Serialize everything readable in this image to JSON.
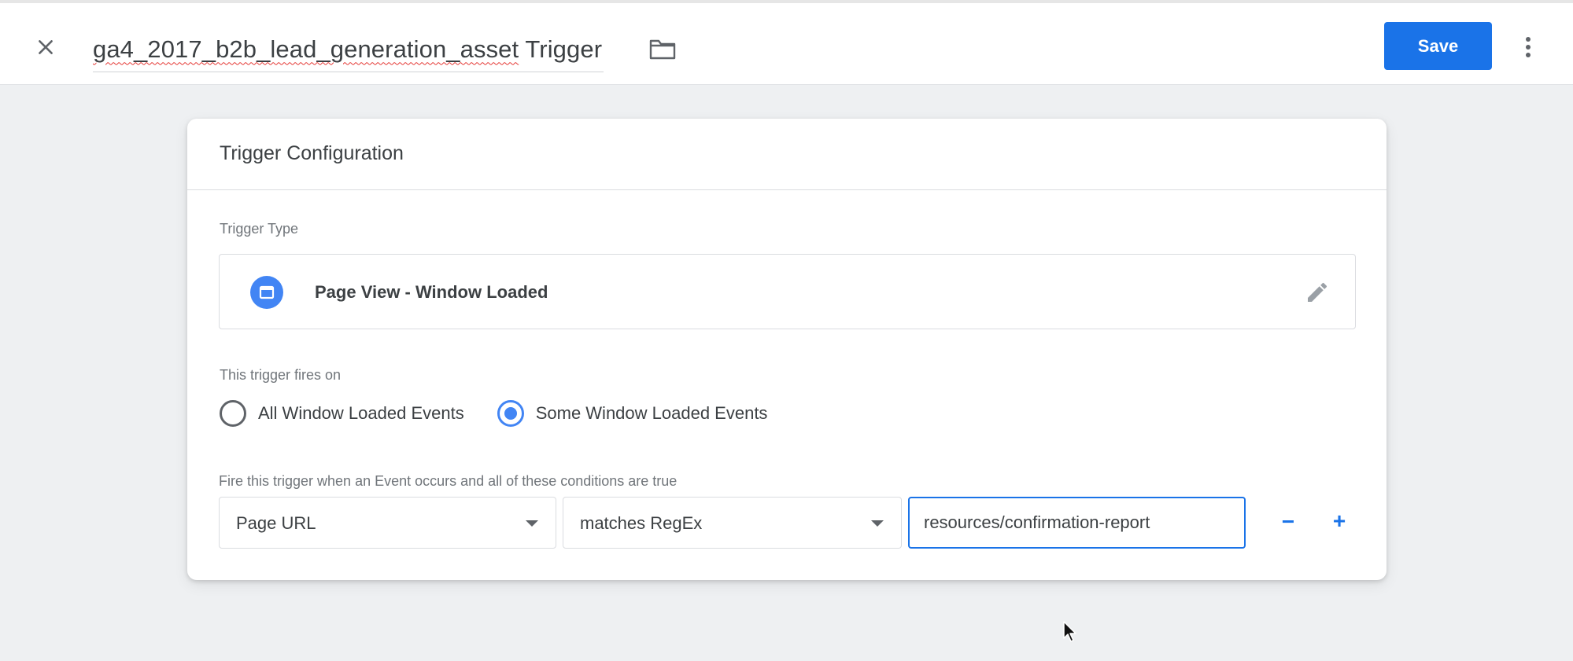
{
  "header": {
    "title_misspelled": "ga4_2017_b2b_lead_generation_asset",
    "title_suffix": " Trigger",
    "save_label": "Save"
  },
  "card": {
    "title": "Trigger Configuration",
    "trigger_type_label": "Trigger Type",
    "trigger_type_name": "Page View - Window Loaded",
    "fires_on_label": "This trigger fires on",
    "options": [
      {
        "label": "All Window Loaded Events",
        "selected": false
      },
      {
        "label": "Some Window Loaded Events",
        "selected": true
      }
    ],
    "conditions_label": "Fire this trigger when an Event occurs and all of these conditions are true",
    "condition": {
      "variable": "Page URL",
      "operator": "matches RegEx",
      "value": "resources/confirmation-report"
    },
    "remove_label": "−",
    "add_label": "+"
  },
  "colors": {
    "accent": "#1a73e8",
    "icon_blue": "#4285f4",
    "background": "#eef0f2"
  },
  "icons": [
    "close-icon",
    "folder-icon",
    "more-vert-icon",
    "page-view-icon",
    "pencil-icon",
    "chevron-down-icon"
  ]
}
